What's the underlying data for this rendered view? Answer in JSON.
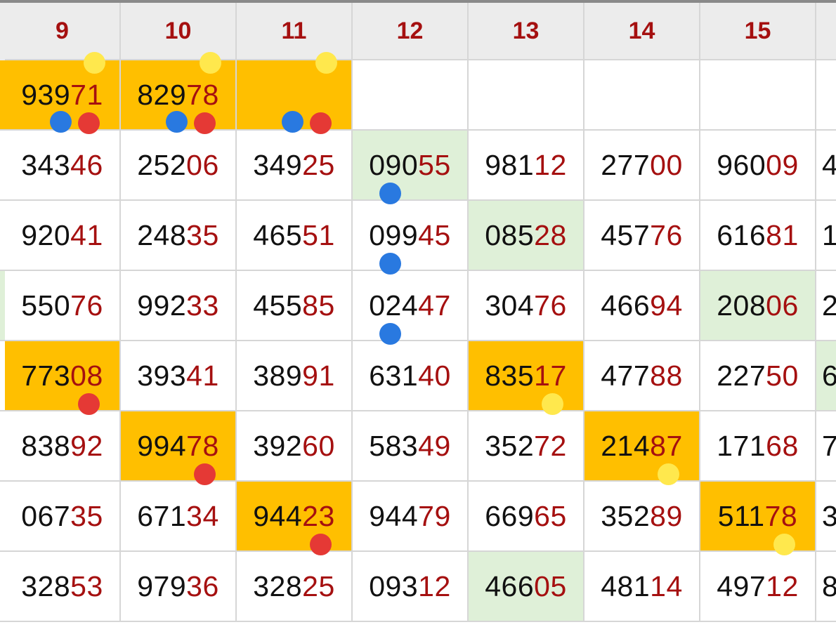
{
  "headers": [
    "9",
    "10",
    "11",
    "12",
    "13",
    "14",
    "15",
    ""
  ],
  "rows": [
    {
      "cells": [
        {
          "prefix": "939",
          "suffix": "71",
          "bg": "orange"
        },
        {
          "prefix": "829",
          "suffix": "78",
          "bg": "orange"
        },
        {
          "prefix": "",
          "suffix": "",
          "bg": "orange"
        },
        {
          "prefix": "",
          "suffix": "",
          "bg": "white"
        },
        {
          "prefix": "",
          "suffix": "",
          "bg": "white"
        },
        {
          "prefix": "",
          "suffix": "",
          "bg": "white"
        },
        {
          "prefix": "",
          "suffix": "",
          "bg": "white"
        },
        {
          "prefix": "",
          "suffix": "",
          "bg": "white"
        }
      ]
    },
    {
      "cells": [
        {
          "prefix": "343",
          "suffix": "46",
          "bg": "white"
        },
        {
          "prefix": "252",
          "suffix": "06",
          "bg": "white"
        },
        {
          "prefix": "349",
          "suffix": "25",
          "bg": "white"
        },
        {
          "prefix": "090",
          "suffix": "55",
          "bg": "green"
        },
        {
          "prefix": "981",
          "suffix": "12",
          "bg": "white"
        },
        {
          "prefix": "277",
          "suffix": "00",
          "bg": "white"
        },
        {
          "prefix": "960",
          "suffix": "09",
          "bg": "white"
        },
        {
          "prefix": "4",
          "suffix": "",
          "bg": "white"
        }
      ]
    },
    {
      "cells": [
        {
          "prefix": "920",
          "suffix": "41",
          "bg": "white"
        },
        {
          "prefix": "248",
          "suffix": "35",
          "bg": "white"
        },
        {
          "prefix": "465",
          "suffix": "51",
          "bg": "white"
        },
        {
          "prefix": "099",
          "suffix": "45",
          "bg": "white"
        },
        {
          "prefix": "085",
          "suffix": "28",
          "bg": "green"
        },
        {
          "prefix": "457",
          "suffix": "76",
          "bg": "white"
        },
        {
          "prefix": "616",
          "suffix": "81",
          "bg": "white"
        },
        {
          "prefix": "1",
          "suffix": "",
          "bg": "white"
        }
      ]
    },
    {
      "cells": [
        {
          "prefix": "550",
          "suffix": "76",
          "bg": "white"
        },
        {
          "prefix": "992",
          "suffix": "33",
          "bg": "white"
        },
        {
          "prefix": "455",
          "suffix": "85",
          "bg": "white"
        },
        {
          "prefix": "024",
          "suffix": "47",
          "bg": "white"
        },
        {
          "prefix": "304",
          "suffix": "76",
          "bg": "white"
        },
        {
          "prefix": "466",
          "suffix": "94",
          "bg": "white"
        },
        {
          "prefix": "208",
          "suffix": "06",
          "bg": "green"
        },
        {
          "prefix": "2",
          "suffix": "",
          "bg": "white"
        }
      ]
    },
    {
      "cells": [
        {
          "prefix": "773",
          "suffix": "08",
          "bg": "orange"
        },
        {
          "prefix": "393",
          "suffix": "41",
          "bg": "white"
        },
        {
          "prefix": "389",
          "suffix": "91",
          "bg": "white"
        },
        {
          "prefix": "631",
          "suffix": "40",
          "bg": "white"
        },
        {
          "prefix": "835",
          "suffix": "17",
          "bg": "orange"
        },
        {
          "prefix": "477",
          "suffix": "88",
          "bg": "white"
        },
        {
          "prefix": "227",
          "suffix": "50",
          "bg": "white"
        },
        {
          "prefix": "6",
          "suffix": "",
          "bg": "green"
        }
      ]
    },
    {
      "cells": [
        {
          "prefix": "838",
          "suffix": "92",
          "bg": "white"
        },
        {
          "prefix": "994",
          "suffix": "78",
          "bg": "orange"
        },
        {
          "prefix": "392",
          "suffix": "60",
          "bg": "white"
        },
        {
          "prefix": "583",
          "suffix": "49",
          "bg": "white"
        },
        {
          "prefix": "352",
          "suffix": "72",
          "bg": "white"
        },
        {
          "prefix": "214",
          "suffix": "87",
          "bg": "orange"
        },
        {
          "prefix": "171",
          "suffix": "68",
          "bg": "white"
        },
        {
          "prefix": "7",
          "suffix": "",
          "bg": "white"
        }
      ]
    },
    {
      "cells": [
        {
          "prefix": "067",
          "suffix": "35",
          "bg": "white"
        },
        {
          "prefix": "671",
          "suffix": "34",
          "bg": "white"
        },
        {
          "prefix": "944",
          "suffix": "23",
          "bg": "orange"
        },
        {
          "prefix": "944",
          "suffix": "79",
          "bg": "white"
        },
        {
          "prefix": "669",
          "suffix": "65",
          "bg": "white"
        },
        {
          "prefix": "352",
          "suffix": "89",
          "bg": "white"
        },
        {
          "prefix": "511",
          "suffix": "78",
          "bg": "orange"
        },
        {
          "prefix": "3",
          "suffix": "",
          "bg": "white"
        }
      ]
    },
    {
      "cells": [
        {
          "prefix": "328",
          "suffix": "53",
          "bg": "white"
        },
        {
          "prefix": "979",
          "suffix": "36",
          "bg": "white"
        },
        {
          "prefix": "328",
          "suffix": "25",
          "bg": "white"
        },
        {
          "prefix": "093",
          "suffix": "12",
          "bg": "white"
        },
        {
          "prefix": "466",
          "suffix": "05",
          "bg": "green"
        },
        {
          "prefix": "481",
          "suffix": "14",
          "bg": "white"
        },
        {
          "prefix": "497",
          "suffix": "12",
          "bg": "white"
        },
        {
          "prefix": "8",
          "suffix": "",
          "bg": "white"
        }
      ]
    }
  ],
  "markers": [
    {
      "color": "yellow",
      "row": 0,
      "col": 0,
      "pos": "top-right"
    },
    {
      "color": "yellow",
      "row": 0,
      "col": 1,
      "pos": "top-right"
    },
    {
      "color": "yellow",
      "row": 0,
      "col": 2,
      "pos": "top-right"
    },
    {
      "color": "blue",
      "row": 0,
      "col": 0,
      "pos": "bottom-mid"
    },
    {
      "color": "red",
      "row": 0,
      "col": 0,
      "pos": "bottom-right"
    },
    {
      "color": "blue",
      "row": 0,
      "col": 1,
      "pos": "bottom-mid"
    },
    {
      "color": "red",
      "row": 0,
      "col": 1,
      "pos": "bottom-right"
    },
    {
      "color": "blue",
      "row": 0,
      "col": 2,
      "pos": "bottom-mid"
    },
    {
      "color": "red",
      "row": 0,
      "col": 2,
      "pos": "bottom-right"
    },
    {
      "color": "blue",
      "row": 1,
      "col": 3,
      "pos": "bottom-center"
    },
    {
      "color": "blue",
      "row": 2,
      "col": 3,
      "pos": "bottom-center"
    },
    {
      "color": "blue",
      "row": 3,
      "col": 3,
      "pos": "bottom-center"
    },
    {
      "color": "red",
      "row": 4,
      "col": 0,
      "pos": "bottom-right"
    },
    {
      "color": "yellow",
      "row": 4,
      "col": 4,
      "pos": "bottom-right"
    },
    {
      "color": "red",
      "row": 5,
      "col": 1,
      "pos": "bottom-right"
    },
    {
      "color": "yellow",
      "row": 5,
      "col": 5,
      "pos": "bottom-right"
    },
    {
      "color": "red",
      "row": 6,
      "col": 2,
      "pos": "bottom-right"
    },
    {
      "color": "yellow",
      "row": 6,
      "col": 6,
      "pos": "bottom-right"
    }
  ],
  "colors": {
    "orange": "#ffbf00",
    "green": "#dff0d8",
    "header_text": "#a51010",
    "digit_black": "#111111",
    "digit_red": "#a51010",
    "dot_yellow": "#ffe84d",
    "dot_red": "#e53935",
    "dot_blue": "#2979e0"
  }
}
